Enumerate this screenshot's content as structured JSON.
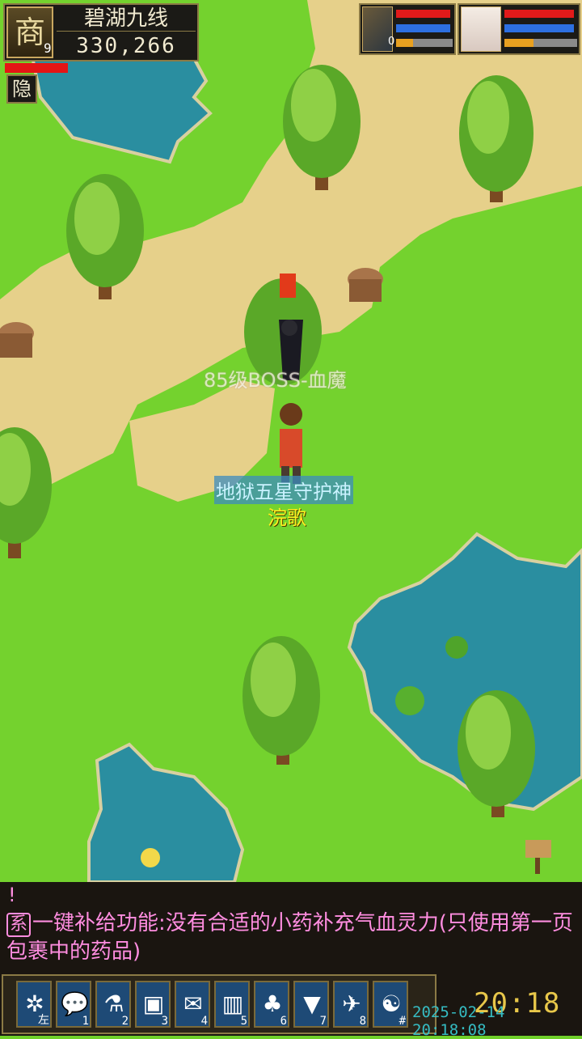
{
  "location": {
    "emblem": "商",
    "level_digit": "9",
    "map_name": "碧湖九线",
    "coords": "330,266",
    "hide_button": "隐"
  },
  "player_status": {
    "hp": 0.95,
    "mp": 0.95,
    "xp": 0.4
  },
  "pet_status": {
    "level_digit": "0",
    "hp": 0.95,
    "mp": 0.95,
    "xp": 0.3
  },
  "map_labels": {
    "boss": "85级BOSS-血魔",
    "player_title": "地狱五星守护神",
    "player_name": "浣歌"
  },
  "chat": {
    "line0": "!",
    "tag": "系",
    "message": "一键补给功能:没有合适的小药补充气血灵力(只使用第一页包裹中的药品)"
  },
  "hotbar": [
    {
      "icon": "settings-icon",
      "glyph": "✲",
      "key": "左"
    },
    {
      "icon": "chat-icon",
      "glyph": "💬",
      "key": "1"
    },
    {
      "icon": "potion-icon",
      "glyph": "⚗",
      "key": "2"
    },
    {
      "icon": "bag-icon",
      "glyph": "▣",
      "key": "3"
    },
    {
      "icon": "scroll-icon",
      "glyph": "✉",
      "key": "4"
    },
    {
      "icon": "card-icon",
      "glyph": "▥",
      "key": "5"
    },
    {
      "icon": "team-icon",
      "glyph": "♣",
      "key": "6"
    },
    {
      "icon": "flag-icon",
      "glyph": "▼",
      "key": "7"
    },
    {
      "icon": "skill-icon",
      "glyph": "✈",
      "key": "8"
    },
    {
      "icon": "mount-icon",
      "glyph": "☯",
      "key": "#"
    }
  ],
  "clock": "20:18",
  "datetime": "2025-02-14 20:18:08",
  "colors": {
    "grass": "#6fcf2a",
    "path": "#e9d590",
    "water": "#2a8ea0",
    "accent": "#8b7a45",
    "chat_text": "#ff8de0"
  }
}
